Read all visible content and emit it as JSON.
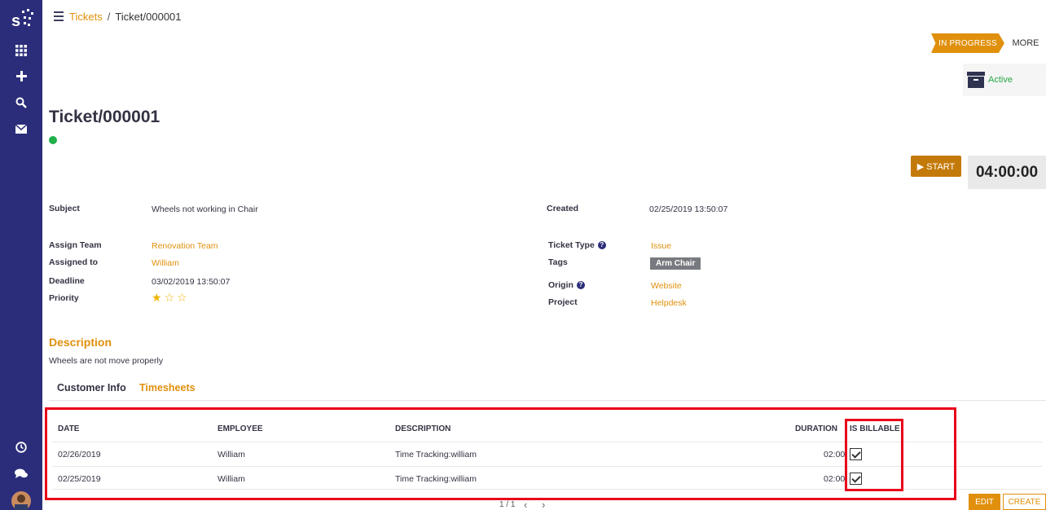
{
  "breadcrumb": {
    "parent": "Tickets",
    "separator": "/",
    "current": "Ticket/000001"
  },
  "status": {
    "current": "IN PROGRESS",
    "more": "MORE",
    "active_label": "Active"
  },
  "ticket": {
    "title": "Ticket/000001"
  },
  "timer": {
    "start_label": "▶ START",
    "value": "04:00:00"
  },
  "fields": {
    "subject_label": "Subject",
    "subject": "Wheels not working in Chair",
    "created_label": "Created",
    "created": "02/25/2019 13:50:07",
    "assign_team_label": "Assign Team",
    "assign_team": "Renovation Team",
    "assigned_to_label": "Assigned to",
    "assigned_to": "William",
    "deadline_label": "Deadline",
    "deadline": "03/02/2019 13:50:07",
    "priority_label": "Priority",
    "priority_stars": 1,
    "priority_max": 3,
    "ticket_type_label": "Ticket Type",
    "ticket_type": "Issue",
    "tags_label": "Tags",
    "tag": "Arm Chair",
    "origin_label": "Origin",
    "origin": "Website",
    "project_label": "Project",
    "project": "Helpdesk",
    "help_glyph": "?"
  },
  "description": {
    "heading": "Description",
    "text": "Wheels are not move properly"
  },
  "tabs": {
    "customer_info": "Customer Info",
    "timesheets": "Timesheets"
  },
  "timesheet": {
    "headers": {
      "date": "DATE",
      "employee": "EMPLOYEE",
      "description": "DESCRIPTION",
      "duration": "DURATION",
      "billable": "IS BILLABLE"
    },
    "rows": [
      {
        "date": "02/26/2019",
        "employee": "William",
        "description": "Time Tracking:william",
        "duration": "02:00",
        "billable": true
      },
      {
        "date": "02/25/2019",
        "employee": "William",
        "description": "Time Tracking:william",
        "duration": "02:00",
        "billable": true
      }
    ]
  },
  "pager": {
    "text": "1 / 1"
  },
  "actions": {
    "edit": "EDIT",
    "create": "CREATE"
  },
  "colors": {
    "accent": "#e0900c",
    "sidebar": "#2b2d7a",
    "active": "#28a745",
    "highlight": "#e8001a"
  },
  "icons": {
    "sidebar_top": [
      "app-logo-icon",
      "apps-grid-icon",
      "plus-icon",
      "search-icon",
      "mail-icon"
    ],
    "sidebar_bottom": [
      "clock-icon",
      "chat-icon",
      "user-avatar"
    ]
  }
}
